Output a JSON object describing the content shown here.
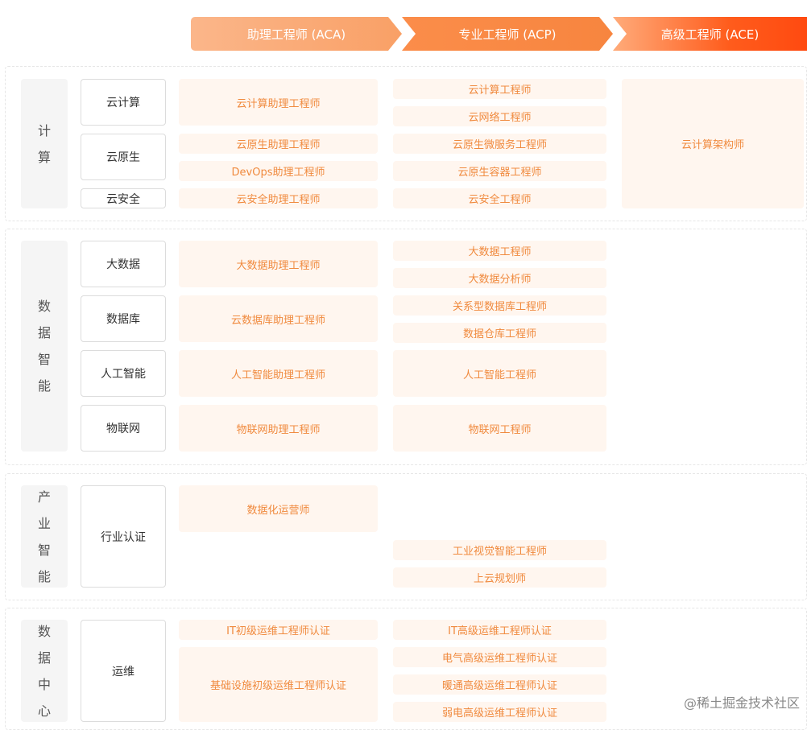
{
  "header": {
    "aca": "助理工程师 (ACA)",
    "acp": "专业工程师 (ACP)",
    "ace": "高级工程师 (ACE)"
  },
  "sections": {
    "compute": {
      "label": [
        "计",
        "算"
      ],
      "subs": {
        "cloud_computing": "云计算",
        "cloud_native": "云原生",
        "cloud_security": "云安全"
      },
      "aca": {
        "cloud_computing": "云计算助理工程师",
        "cloud_native": "云原生助理工程师",
        "devops": "DevOps助理工程师",
        "cloud_security": "云安全助理工程师"
      },
      "acp": {
        "cloud_computing": "云计算工程师",
        "cloud_network": "云网络工程师",
        "microservices": "云原生微服务工程师",
        "container": "云原生容器工程师",
        "cloud_security": "云安全工程师"
      },
      "ace": {
        "architect": "云计算架构师"
      }
    },
    "data_intelligence": {
      "label": [
        "数",
        "据",
        "智",
        "能"
      ],
      "subs": {
        "big_data": "大数据",
        "database": "数据库",
        "ai": "人工智能",
        "iot": "物联网"
      },
      "aca": {
        "big_data": "大数据助理工程师",
        "database": "云数据库助理工程师",
        "ai": "人工智能助理工程师",
        "iot": "物联网助理工程师"
      },
      "acp": {
        "big_data_engineer": "大数据工程师",
        "big_data_analyst": "大数据分析师",
        "relational_db": "关系型数据库工程师",
        "data_warehouse": "数据仓库工程师",
        "ai": "人工智能工程师",
        "iot": "物联网工程师"
      }
    },
    "industry_intelligence": {
      "label": [
        "产",
        "业",
        "智",
        "能"
      ],
      "subs": {
        "industry_cert": "行业认证"
      },
      "aca": {
        "digital_ops": "数据化运营师"
      },
      "acp": {
        "industrial_vision": "工业视觉智能工程师",
        "cloud_planner": "上云规划师"
      }
    },
    "data_center": {
      "label": [
        "数",
        "据",
        "中",
        "心"
      ],
      "subs": {
        "ops": "运维"
      },
      "aca": {
        "it_junior": "IT初级运维工程师认证",
        "infra_junior": "基础设施初级运维工程师认证"
      },
      "acp": {
        "it_senior": "IT高级运维工程师认证",
        "electrical_senior": "电气高级运维工程师认证",
        "hvac_senior": "暖通高级运维工程师认证",
        "weak_current_senior": "弱电高级运维工程师认证"
      }
    }
  },
  "watermark": "@稀土掘金技术社区"
}
